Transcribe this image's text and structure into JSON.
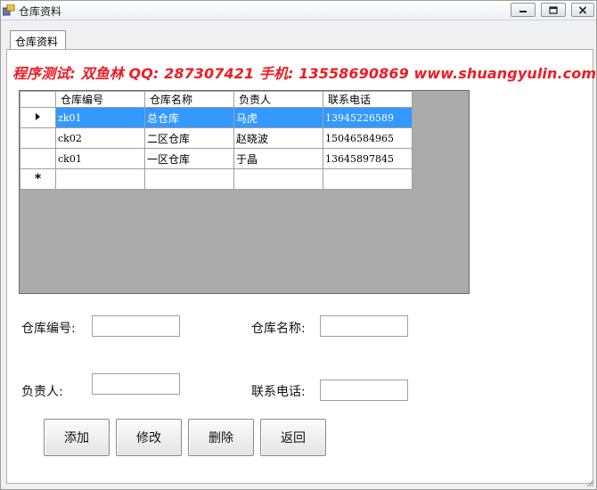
{
  "window": {
    "title": "仓库资料"
  },
  "tab": {
    "label": "仓库资料"
  },
  "banner": {
    "text": "程序测试: 双鱼林   QQ: 287307421   手机: 13558690869   www.shuangyulin.com",
    "color": "#ee1c25"
  },
  "grid": {
    "columns": [
      "仓库编号",
      "仓库名称",
      "负责人",
      "联系电话"
    ],
    "rows": [
      {
        "code": "zk01",
        "name": "总仓库",
        "manager": "马虎",
        "phone": "13945226589",
        "selected": true
      },
      {
        "code": "ck02",
        "name": "二区仓库",
        "manager": "赵晓波",
        "phone": "15046584965",
        "selected": false
      },
      {
        "code": "ck01",
        "name": "一区仓库",
        "manager": "于晶",
        "phone": "13645897845",
        "selected": false
      }
    ],
    "new_row_marker": "*",
    "selection_color": "#3399ff"
  },
  "form": {
    "code_label": "仓库编号:",
    "code_value": "",
    "name_label": "仓库名称:",
    "name_value": "",
    "manager_label": "负责人:",
    "manager_value": "",
    "phone_label": "联系电话:",
    "phone_value": ""
  },
  "buttons": {
    "add": "添加",
    "edit": "修改",
    "delete": "删除",
    "back": "返回"
  }
}
